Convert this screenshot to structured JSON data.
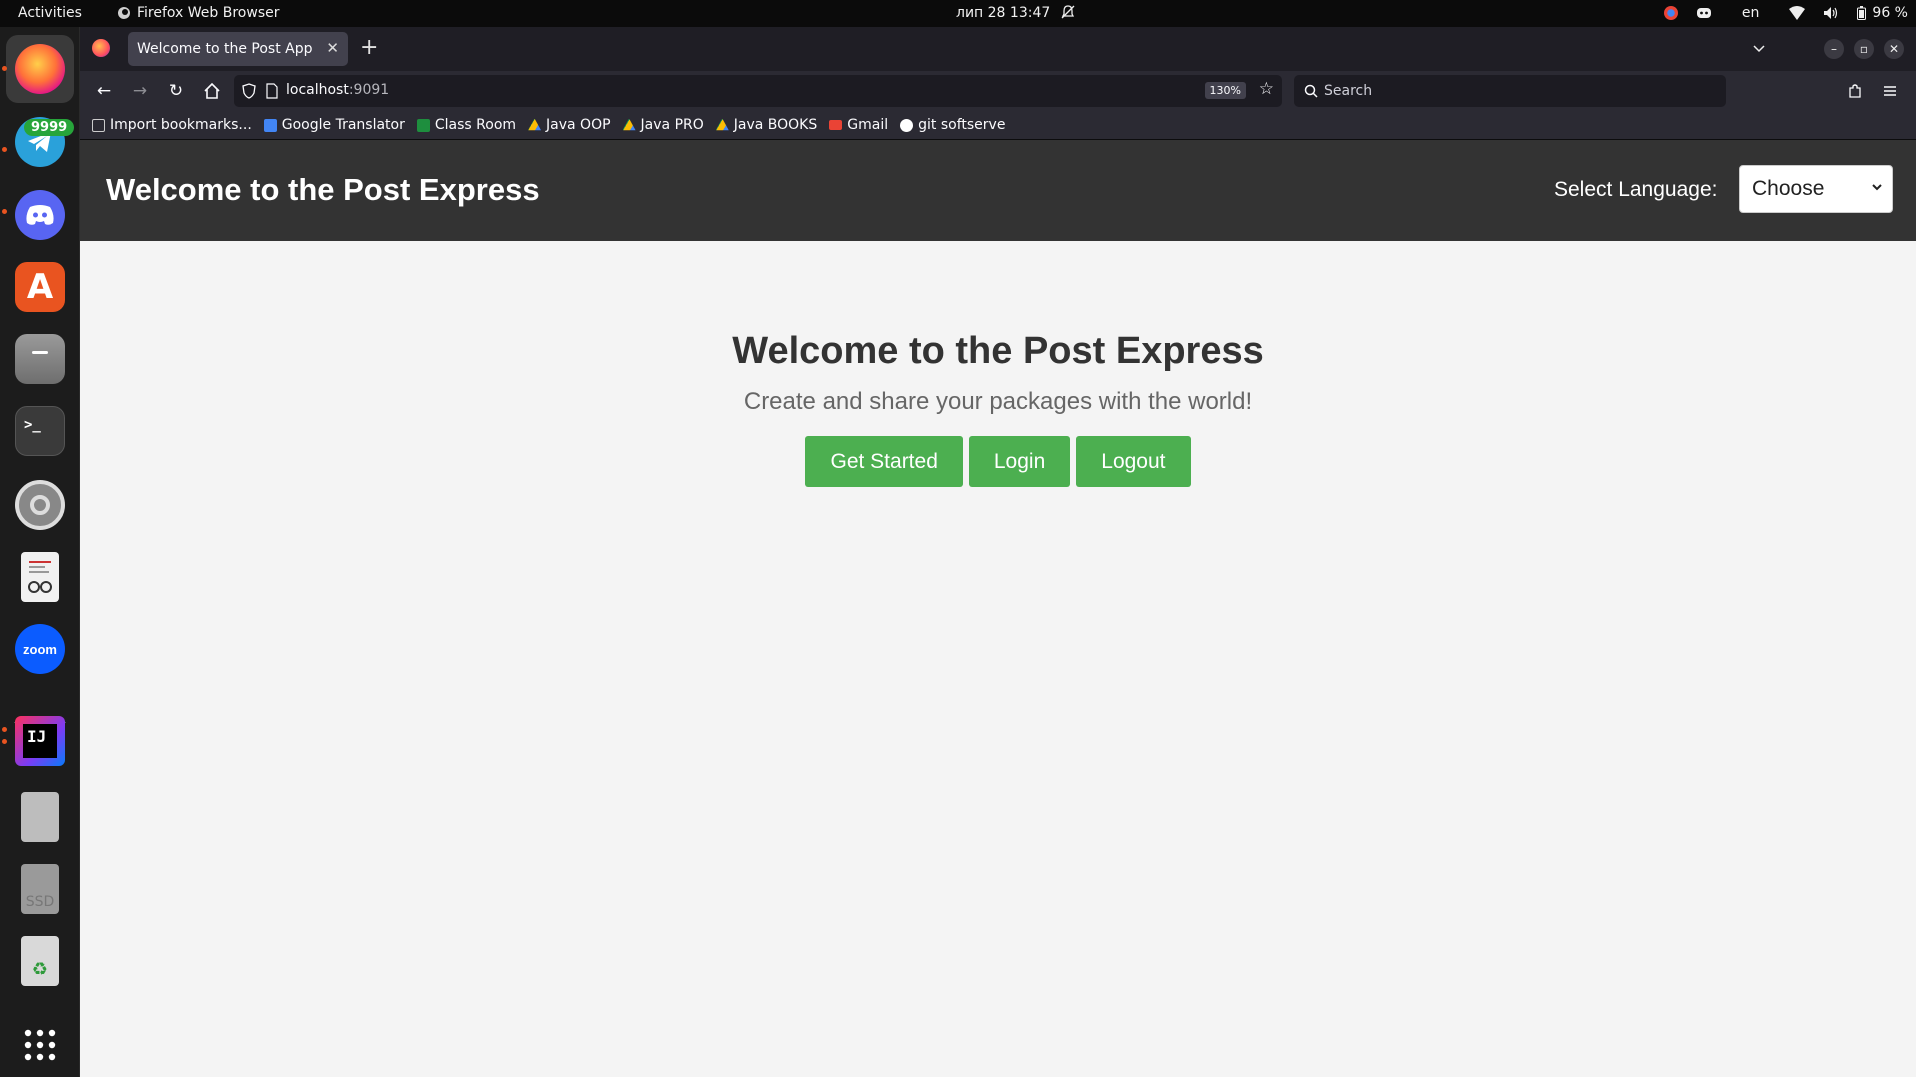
{
  "topbar": {
    "activities": "Activities",
    "app_name": "Firefox Web Browser",
    "clock": "лип 28  13:47",
    "keyboard_layout": "en",
    "battery": "96 %"
  },
  "dock": {
    "telegram_badge": "9999",
    "zoom_label": "zoom",
    "intellij_label": "IJ",
    "ssd_label": "SSD"
  },
  "browser": {
    "tab_title": "Welcome to the Post App",
    "url_host": "localhost",
    "url_port": ":9091",
    "zoom_level": "130%",
    "search_placeholder": "Search",
    "bookmarks": [
      {
        "label": "Import bookmarks...",
        "icon": "import-icon",
        "color": "#cccccc"
      },
      {
        "label": "Google Translator",
        "icon": "google-translate-icon",
        "color": "#4285f4"
      },
      {
        "label": "Class Room",
        "icon": "classroom-icon",
        "color": "#1e8e3e"
      },
      {
        "label": "Java OOP",
        "icon": "google-drive-icon",
        "color": "#fbbc04"
      },
      {
        "label": "Java PRO",
        "icon": "google-drive-icon",
        "color": "#fbbc04"
      },
      {
        "label": "Java BOOKS",
        "icon": "google-drive-icon",
        "color": "#fbbc04"
      },
      {
        "label": "Gmail",
        "icon": "gmail-icon",
        "color": "#ea4335"
      },
      {
        "label": "git softserve",
        "icon": "github-icon",
        "color": "#ffffff"
      }
    ]
  },
  "site": {
    "header_title": "Welcome to the Post Express",
    "language_label": "Select Language:",
    "language_selected": "Choose",
    "hero_title": "Welcome to the Post Express",
    "hero_subtitle": "Create and share your packages with the world!",
    "buttons": {
      "get_started": "Get Started",
      "login": "Login",
      "logout": "Logout"
    },
    "colors": {
      "header_bg": "#333333",
      "button_green": "#4caf50",
      "page_bg": "#f4f4f4"
    }
  }
}
